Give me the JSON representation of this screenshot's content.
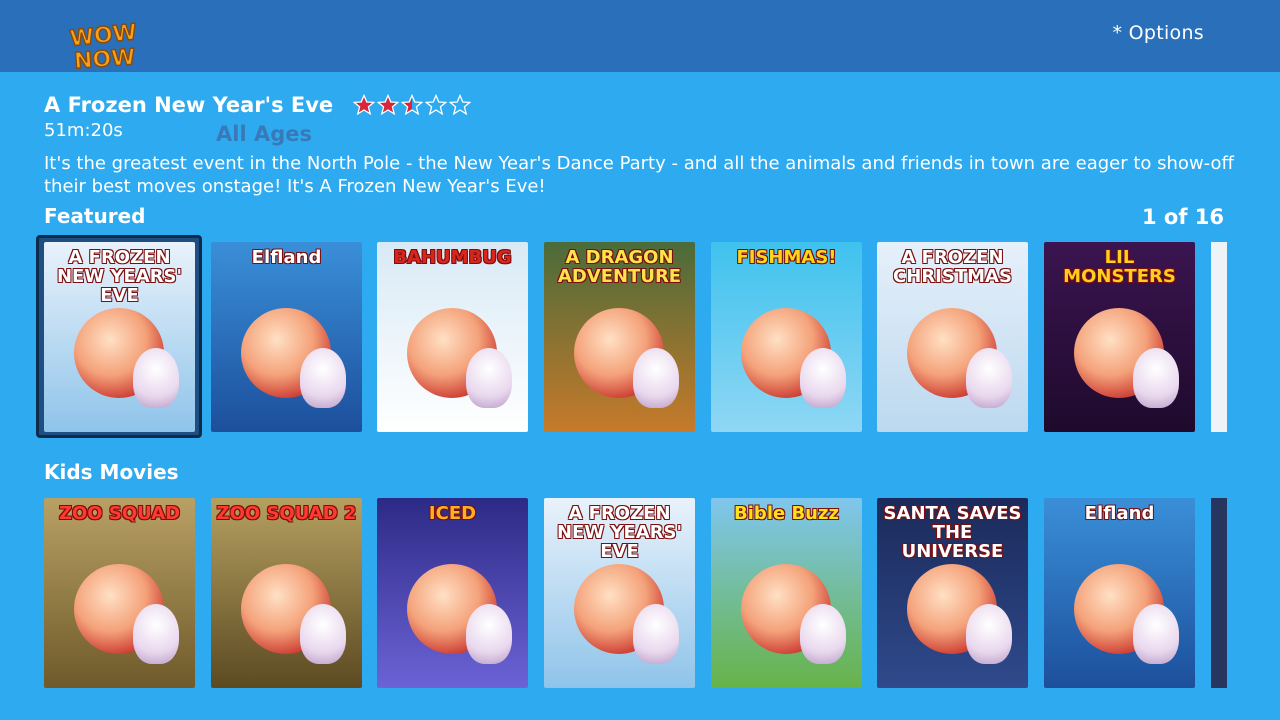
{
  "app": {
    "logo_text": "WOW NOW",
    "options_label": "* Options"
  },
  "details": {
    "title": "A Frozen New Year's Eve",
    "stars_filled": 2.5,
    "stars_total": 5,
    "duration": "51m:20s",
    "rating": "All Ages",
    "description": "It's the greatest event in the North Pole - the New Year's Dance Party - and all the animals and friends in town are eager to show-off their best moves onstage!  It's A Frozen New Year's Eve!"
  },
  "rows": [
    {
      "label": "Featured",
      "count": "1 of 16",
      "posters": [
        {
          "title": "A FROZEN NEW YEARS' EVE",
          "colors": [
            "#e9f2fb",
            "#8fc4ea"
          ],
          "title_color": "#ffffff"
        },
        {
          "title": "Elfland",
          "colors": [
            "#3a8fd8",
            "#1c4f9c"
          ],
          "title_color": "#ffffff"
        },
        {
          "title": "BAHUMBUG",
          "colors": [
            "#d8eaf6",
            "#ffffff"
          ],
          "title_color": "#d9261c"
        },
        {
          "title": "A DRAGON ADVENTURE",
          "colors": [
            "#4a6b3a",
            "#c77a2a"
          ],
          "title_color": "#ffe34a"
        },
        {
          "title": "FISHMAS!",
          "colors": [
            "#3fc2ee",
            "#8fd7f4"
          ],
          "title_color": "#ffd51a"
        },
        {
          "title": "A FROZEN CHRISTMAS",
          "colors": [
            "#e6f0fa",
            "#bcd8ef"
          ],
          "title_color": "#ffffff"
        },
        {
          "title": "LIL MONSTERS",
          "colors": [
            "#3b1450",
            "#1e0a2c"
          ],
          "title_color": "#ffcf1f"
        }
      ]
    },
    {
      "label": "Kids Movies",
      "posters": [
        {
          "title": "ZOO SQUAD",
          "colors": [
            "#b9a165",
            "#6e5a2a"
          ],
          "title_color": "#ff3a2e"
        },
        {
          "title": "ZOO SQUAD 2",
          "colors": [
            "#b5a060",
            "#5c4a22"
          ],
          "title_color": "#ff3a2e"
        },
        {
          "title": "ICED",
          "colors": [
            "#2d2a86",
            "#6b63d6"
          ],
          "title_color": "#ffb01f"
        },
        {
          "title": "A FROZEN NEW YEARS' EVE",
          "colors": [
            "#e9f2fb",
            "#8fc4ea"
          ],
          "title_color": "#ffffff"
        },
        {
          "title": "Bible Buzz",
          "colors": [
            "#7fc6ee",
            "#67b348"
          ],
          "title_color": "#ffe01a"
        },
        {
          "title": "SANTA SAVES THE UNIVERSE",
          "colors": [
            "#1b2a5a",
            "#2f4a8c"
          ],
          "title_color": "#ffffff"
        },
        {
          "title": "Elfland",
          "colors": [
            "#3a8fd8",
            "#1c4f9c"
          ],
          "title_color": "#ffffff"
        }
      ]
    }
  ],
  "colors": {
    "background": "#2eaaf0",
    "topbar": "#2a6fba",
    "star_filled": "#d8263a",
    "star_empty": "#ffffff",
    "rating_text": "#3a79b8"
  }
}
